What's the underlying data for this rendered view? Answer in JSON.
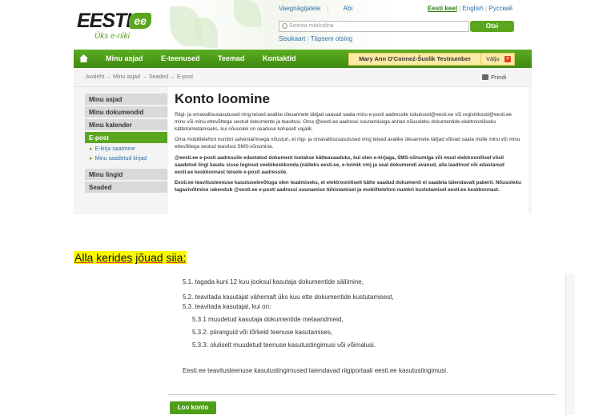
{
  "header": {
    "logo_text": "EESTI",
    "logo_badge": "ee",
    "logo_sub": "Üks e-riiki",
    "top_links": [
      "Vaegnägijatele",
      "Abi"
    ],
    "languages": [
      "Eesti keel",
      "English",
      "Русский"
    ],
    "search_placeholder": "Sisesta märksõna",
    "search_button": "Otsi",
    "sub_links": [
      "Sisukaart",
      "Täpsem otsing"
    ]
  },
  "nav": {
    "items": [
      "Minu asjad",
      "E-teenused",
      "Teemad",
      "Kontaktid"
    ],
    "user": "Mary Ann O'Conneź-Šuslik Testnumber",
    "logout": "Välju"
  },
  "breadcrumb": "Avaleht  →  Minu asjad  →  Seaded  →  E-post",
  "print_label": "Prindi",
  "sidebar": {
    "items": [
      "Minu asjad",
      "Minu dokumendid",
      "Minu kalender",
      "E-post"
    ],
    "subitems": [
      "E-kirja saatmine",
      "Minu saadetud kirjad"
    ],
    "items2": [
      "Minu lingid",
      "Seaded"
    ]
  },
  "main": {
    "title": "Konto loomine",
    "p1": "Riigi- ja omavalitsusasutused ning teised avalike ülesannete täitjad saavad saata minu e-posti aadressile isikukood@eesti.ee või registrikood@eesti.ee minu või minu ettevõttega seotud dokumente ja teavitusi. Oma @eesti.ee aadressi suunamisega annan nõusoleku dokumentide elektrooniliseks kättetoimetamiseks, kui nõusolek on seaduse kohaselt vajalik.",
    "p2": "Oma mobiiltelefoni numbri salvestamisega nõustun, et riigi- ja omavalitsusasutused ning teised avalike ülesannete täitjad võivad saata mulle minu või minu ettevõttega seotud teavitusi SMS-sõnumina.",
    "p3": "@eesti.ee e-posti aadressile edastatud dokument loetakse kätteasaaduks, kui olen e-kirjaga, SMS-sõnumiga või muul elektroonilisel viisil saadetud lingi kaudu sisse loginud veebikeskkonda (näiteks eesti.ee, e-toimik vm) ja seal dokumendi avanud, alla laadinud või edastanud eesti.ee keskkonnast teisele e-posti aadressile.",
    "p4": "Eesti.ee teavitusteenuse kasutuselevõtuga olen teadmiseks, et elektrooniliselt kätte saadud dokumenti ei saadeta täiendavalt paberil. Nõusoleku tagasivõtmine rakendub @eesti.ee e-posti aadressi suunamise tühistamisel ja mobiiltelefoni numbri kustutamisel eesti.ee keskkonnast."
  },
  "caption": {
    "words": [
      "Alla",
      "kerides",
      "jõuad",
      "siia:"
    ]
  },
  "terms": {
    "items": [
      "5.1. tagada kuni 12 kuu jooksul kasutaja dokumentide säilimine,",
      "5.2. teavitada kasutajat vähemalt üks kuu ette dokumentide kustutamisest,",
      "5.3. teavitada kasutajat, kui on:",
      "5.3.1 muudetud kasutaja dokumentide metaandmeid,",
      "5.3.2. piiranguid või tõrkeid teenuse kasutamises,",
      "5.3.3. oluliselt muudetud teenuse kasutustingimusi või võimalusi."
    ],
    "footer": "Eesti.ee teavitusteenuse kasutustingimused laiendavad riigiportaali eesti.ee kasutustingimusi.",
    "button": "Loo konto"
  }
}
